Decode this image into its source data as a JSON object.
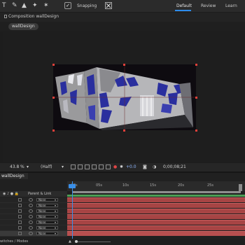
{
  "toolbar": {
    "tools": [
      "T",
      "✎",
      "▲",
      "✦",
      "✶"
    ],
    "snapping_label": "Snapping",
    "snapping_checked": true
  },
  "workspaces": {
    "items": [
      "Default",
      "Review",
      "Learn"
    ],
    "active": "Default",
    "accent": "#2d8ceb"
  },
  "composition": {
    "tab_title": "Composition wallDesign",
    "crumb": "wallDesign",
    "handle_color": "#e0403a"
  },
  "viewer_toolbar": {
    "zoom": "43.8",
    "zoom_unit": "%",
    "resolution": "(Half)",
    "exposure": "+0.0",
    "timecode": "0;00;08;21"
  },
  "timeline": {
    "tab_name": "wallDesign",
    "ruler_ticks": [
      ":00s",
      "05s",
      "10s",
      "15s",
      "20s",
      "25s"
    ],
    "parent_header": "Parent & Link",
    "layers": [
      {
        "parent": "None",
        "selected": false
      },
      {
        "parent": "None",
        "selected": false
      },
      {
        "parent": "None",
        "selected": false
      },
      {
        "parent": "None",
        "selected": false
      },
      {
        "parent": "None",
        "selected": false
      },
      {
        "parent": "None",
        "selected": false
      },
      {
        "parent": "None",
        "selected": true
      }
    ],
    "layer_bar_color": "#a74444",
    "footer": "witches / Modes"
  }
}
